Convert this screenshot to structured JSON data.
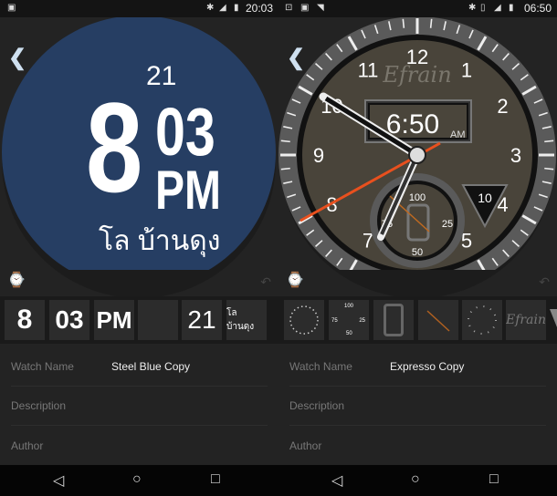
{
  "left": {
    "status": {
      "time": "20:03",
      "icons": [
        "image-icon",
        "bluetooth-icon",
        "signal-icon",
        "battery-icon"
      ]
    },
    "watch": {
      "date": "21",
      "hour": "8",
      "minute": "03",
      "ampm": "PM",
      "location": "โล บ้านดุง",
      "face_color": "#263e63"
    },
    "thumbnails": [
      "8",
      "03",
      "PM",
      "",
      "21",
      "โล บ้านดุง"
    ],
    "form": {
      "watch_name_label": "Watch Name",
      "watch_name": "Steel Blue Copy",
      "description_label": "Description",
      "author_label": "Author"
    }
  },
  "right": {
    "status": {
      "time": "06:50",
      "icons": [
        "app-icon",
        "image-icon",
        "wifi-icon",
        "bluetooth-icon",
        "vibrate-icon",
        "signal-icon",
        "battery-icon"
      ]
    },
    "watch": {
      "numerals": [
        "12",
        "1",
        "2",
        "3",
        "4",
        "5",
        "6",
        "7",
        "8",
        "9",
        "10",
        "11"
      ],
      "brand": "Efrain",
      "digital_time": "6:50",
      "ampm": "AM",
      "date": "10",
      "battery_labels": [
        "100",
        "25",
        "50",
        "75"
      ],
      "face_color": "#49443a",
      "second_hand_color": "#e8501e"
    },
    "thumbnails": {
      "battery_labels": [
        "100",
        "75",
        "25",
        "50"
      ],
      "brand": "Efrain"
    },
    "form": {
      "watch_name_label": "Watch Name",
      "watch_name": "Expresso Copy",
      "description_label": "Description",
      "author_label": "Author"
    }
  },
  "nav": {
    "back": "◁",
    "home": "○",
    "recents": "□"
  }
}
